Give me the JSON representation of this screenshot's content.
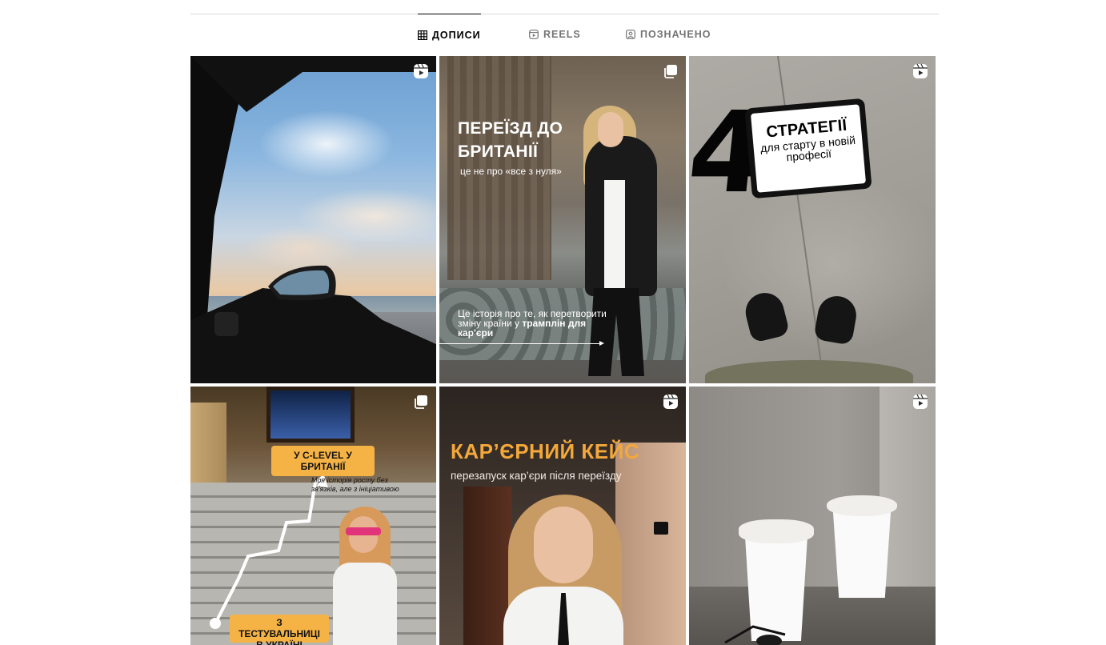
{
  "tabs": {
    "posts": "ДОПИСИ",
    "reels": "REELS",
    "tagged": "ПОЗНАЧЕНО",
    "active": "posts"
  },
  "grid": {
    "posts": [
      {
        "type": "reel",
        "icon": "reel-icon"
      },
      {
        "type": "carousel",
        "icon": "carousel-icon",
        "title": "ПЕРЕЇЗД ДО БРИТАНІЇ",
        "subtitle": "це не про «все з нуля»",
        "body": "Це історія про те, як перетворити зміну країни у",
        "body_bold": "трамплін для кар'єри"
      },
      {
        "type": "reel",
        "icon": "reel-icon",
        "number": "4",
        "card_title": "СТРАТЕГІЇ",
        "card_text": "для старту в новій професії"
      },
      {
        "type": "carousel",
        "icon": "carousel-icon",
        "label_top": "У C-LEVEL У БРИТАНІЇ",
        "subtitle": "Моя історія росту без зв'язків, але з ініціативою",
        "label_bottom": "З ТЕСТУВАЛЬНИЦІ В УКРАЇНІ"
      },
      {
        "type": "reel",
        "icon": "reel-icon",
        "title": "КАР’ЄРНИЙ КЕЙС",
        "subtitle": "перезапуск кар’єри після переїзду"
      },
      {
        "type": "reel",
        "icon": "reel-icon"
      }
    ]
  },
  "colors": {
    "accent_orange": "#f4a83a",
    "label_orange": "#f6b345",
    "tab_active": "#000000",
    "tab_inactive": "#737373"
  }
}
